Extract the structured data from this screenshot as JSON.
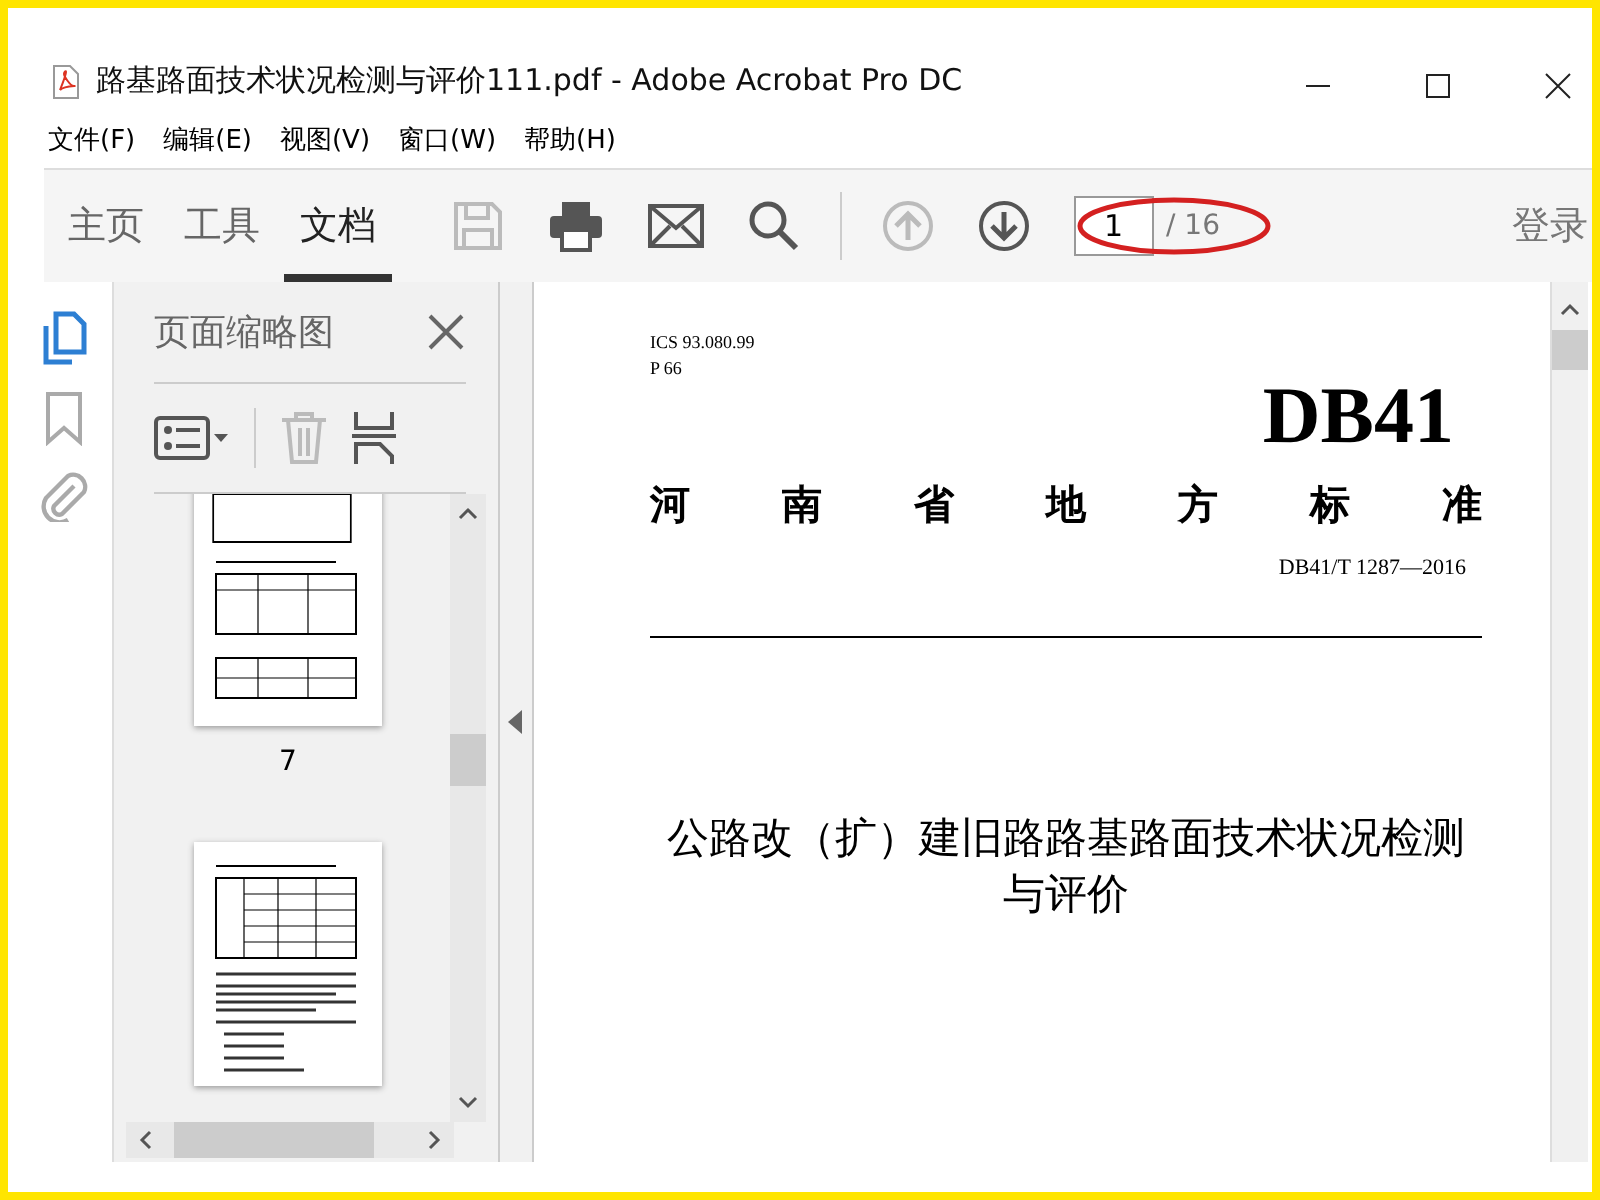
{
  "window": {
    "title": "路基路面技术状况检测与评价111.pdf - Adobe Acrobat Pro DC"
  },
  "menu": [
    "文件(F)",
    "编辑(E)",
    "视图(V)",
    "窗口(W)",
    "帮助(H)"
  ],
  "tabs": [
    {
      "label": "主页",
      "selected": false
    },
    {
      "label": "工具",
      "selected": false
    },
    {
      "label": "文档",
      "selected": true
    }
  ],
  "page_nav": {
    "current": "1",
    "total": "/ 16"
  },
  "sign_in": "登录",
  "rail": [
    {
      "kind": "pages",
      "selected": true
    },
    {
      "kind": "bookmarks",
      "selected": false
    },
    {
      "kind": "attachments",
      "selected": false
    }
  ],
  "thumbnail_panel": {
    "title": "页面缩略图",
    "page_labels": [
      "7"
    ]
  },
  "document": {
    "ics": "ICS  93.080.99",
    "class_code": "P 66",
    "code": "DB41",
    "issuer": "河南省地方标准",
    "standard_no": "DB41/T 1287—2016",
    "title": "公路改（扩）建旧路路基路面技术状况检测与评价"
  }
}
